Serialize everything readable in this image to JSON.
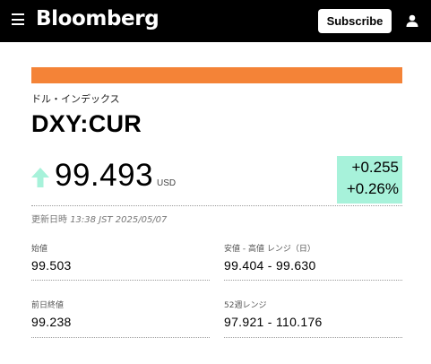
{
  "header": {
    "logo": "Bloomberg",
    "subscribe_label": "Subscribe",
    "menu_icon": "hamburger-menu-icon",
    "user_icon": "user-account-icon"
  },
  "accent_color": "#f48337",
  "security": {
    "name": "ドル・インデックス",
    "ticker": "DXY:CUR",
    "price": "99.493",
    "currency": "USD",
    "direction": "up",
    "change_abs": "+0.255",
    "change_pct": "+0.26%",
    "change_color": "#a7f2da",
    "updated_label": "更新日時",
    "updated_time": "13:38 JST 2025/05/07"
  },
  "stats": {
    "open_label": "始値",
    "open_value": "99.503",
    "day_range_label": "安値 - 高値 レンジ（日）",
    "day_range_value": "99.404 - 99.630",
    "prev_close_label": "前日終値",
    "prev_close_value": "99.238",
    "week52_label": "52週レンジ",
    "week52_value": "97.921 - 110.176"
  }
}
